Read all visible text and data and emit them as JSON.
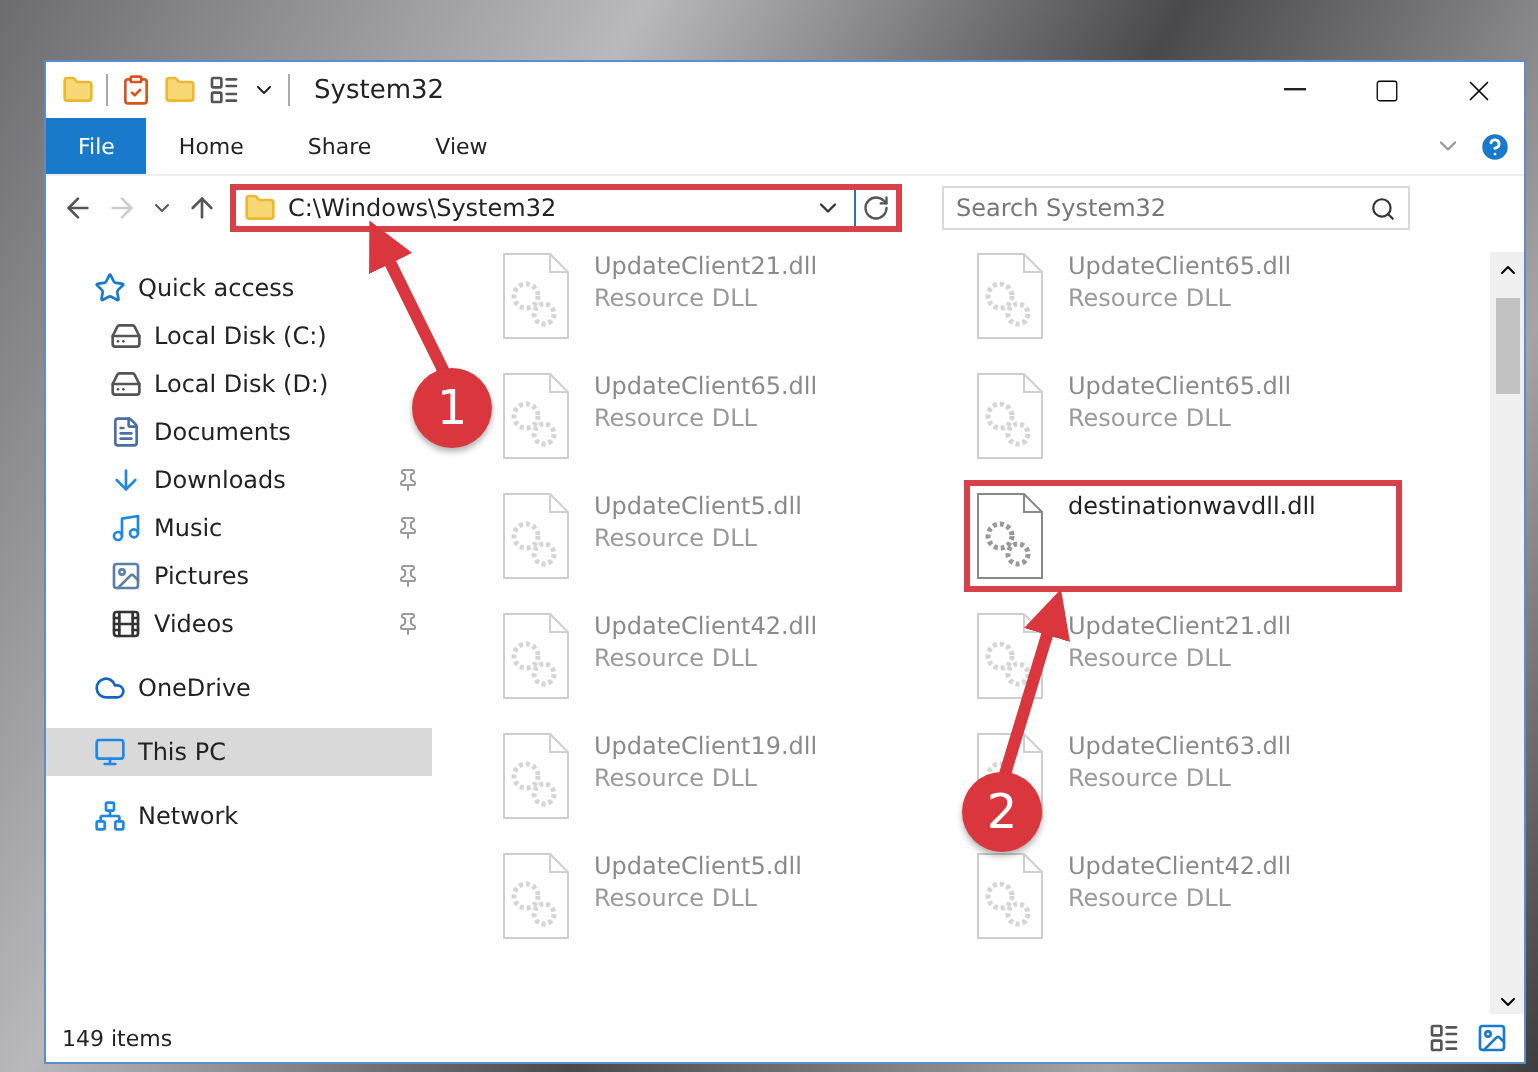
{
  "window": {
    "title": "System32"
  },
  "ribbon_tabs": [
    {
      "label": "File",
      "selected": true
    },
    {
      "label": "Home",
      "selected": false
    },
    {
      "label": "Share",
      "selected": false
    },
    {
      "label": "View",
      "selected": false
    }
  ],
  "address_bar": {
    "value": "C:\\Windows\\System32",
    "highlighted": true
  },
  "search": {
    "placeholder": "Search System32"
  },
  "sidebar": {
    "items": [
      {
        "label": "Quick access",
        "selected": false,
        "children": [
          {
            "label": "Local Disk (C:)",
            "pinned": false,
            "selected": false
          },
          {
            "label": "Local Disk (D:)",
            "pinned": false,
            "selected": false
          },
          {
            "label": "Documents",
            "pinned": false,
            "selected": false
          },
          {
            "label": "Downloads",
            "pinned": true,
            "selected": false
          },
          {
            "label": "Music",
            "pinned": true,
            "selected": false
          },
          {
            "label": "Pictures",
            "pinned": true,
            "selected": false
          },
          {
            "label": "Videos",
            "pinned": true,
            "selected": false
          }
        ]
      },
      {
        "label": "OneDrive",
        "selected": false
      },
      {
        "label": "This PC",
        "selected": true
      },
      {
        "label": "Network",
        "selected": false
      }
    ]
  },
  "files": [
    {
      "name": "UpdateClient21.dll",
      "type": "Resource DLL",
      "faded": true,
      "highlighted": false
    },
    {
      "name": "UpdateClient65.dll",
      "type": "Resource DLL",
      "faded": true,
      "highlighted": false
    },
    {
      "name": "UpdateClient65.dll",
      "type": "Resource DLL",
      "faded": true,
      "highlighted": false
    },
    {
      "name": "UpdateClient65.dll",
      "type": "Resource DLL",
      "faded": true,
      "highlighted": false
    },
    {
      "name": "UpdateClient5.dll",
      "type": "Resource DLL",
      "faded": true,
      "highlighted": false
    },
    {
      "name": "destinationwavdll.dll",
      "faded": false,
      "highlighted": true
    },
    {
      "name": "UpdateClient42.dll",
      "type": "Resource DLL",
      "faded": true,
      "highlighted": false
    },
    {
      "name": "UpdateClient21.dll",
      "type": "Resource DLL",
      "faded": true,
      "highlighted": false
    },
    {
      "name": "UpdateClient19.dll",
      "type": "Resource DLL",
      "faded": true,
      "highlighted": false
    },
    {
      "name": "UpdateClient63.dll",
      "type": "Resource DLL",
      "faded": true,
      "highlighted": false
    },
    {
      "name": "UpdateClient5.dll",
      "type": "Resource DLL",
      "faded": true,
      "highlighted": false
    },
    {
      "name": "UpdateClient42.dll",
      "type": "Resource DLL",
      "faded": true,
      "highlighted": false
    }
  ],
  "status_bar": {
    "item_count": "149 items"
  },
  "annotations": [
    {
      "number": "1"
    },
    {
      "number": "2"
    }
  ]
}
